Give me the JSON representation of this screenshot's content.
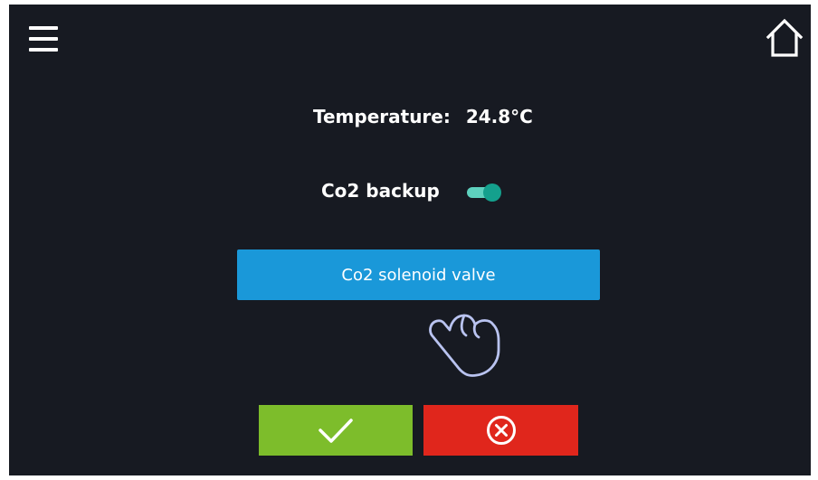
{
  "header": {
    "menu_icon": "hamburger-menu-icon",
    "home_icon": "home-icon"
  },
  "temperature": {
    "label": "Temperature:",
    "value": "24.8°C"
  },
  "co2_backup": {
    "label": "Co2 backup",
    "enabled": true,
    "toggle_color": "#14a08d"
  },
  "valve_button": {
    "label": "Co2 solenoid valve",
    "color": "#1a98d9"
  },
  "hint_icon": "tap-hand-icon",
  "actions": {
    "confirm_icon": "checkmark-icon",
    "confirm_color": "#7dbd2b",
    "cancel_icon": "close-circle-icon",
    "cancel_color": "#e0261c"
  }
}
